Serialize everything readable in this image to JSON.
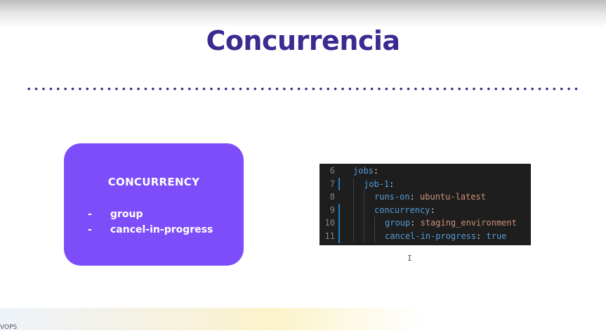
{
  "slide": {
    "title": "Concurrencia",
    "colors": {
      "title": "#3b2a8f",
      "card_background": "#7d4dfa",
      "code_background": "#1e1e1e"
    }
  },
  "card": {
    "heading": "CONCURRENCY",
    "items": [
      {
        "dash": "-",
        "text": "group"
      },
      {
        "dash": "-",
        "text": "cancel-in-progress"
      }
    ]
  },
  "code": {
    "lines": [
      {
        "num": "6",
        "key": "jobs",
        "sep": ":",
        "value": ""
      },
      {
        "num": "7",
        "key": "job-1",
        "sep": ":",
        "value": ""
      },
      {
        "num": "8",
        "key": "runs-on",
        "sep": ": ",
        "value": "ubuntu-latest"
      },
      {
        "num": "9",
        "key": "concurrency",
        "sep": ":",
        "value": ""
      },
      {
        "num": "10",
        "key": "group",
        "sep": ": ",
        "value": "staging_environment"
      },
      {
        "num": "11",
        "key": "cancel-in-progress",
        "sep": ": ",
        "value": "true"
      }
    ]
  },
  "cursor": {
    "glyph": "I"
  },
  "footer": {
    "partial_text": "VOPS"
  }
}
